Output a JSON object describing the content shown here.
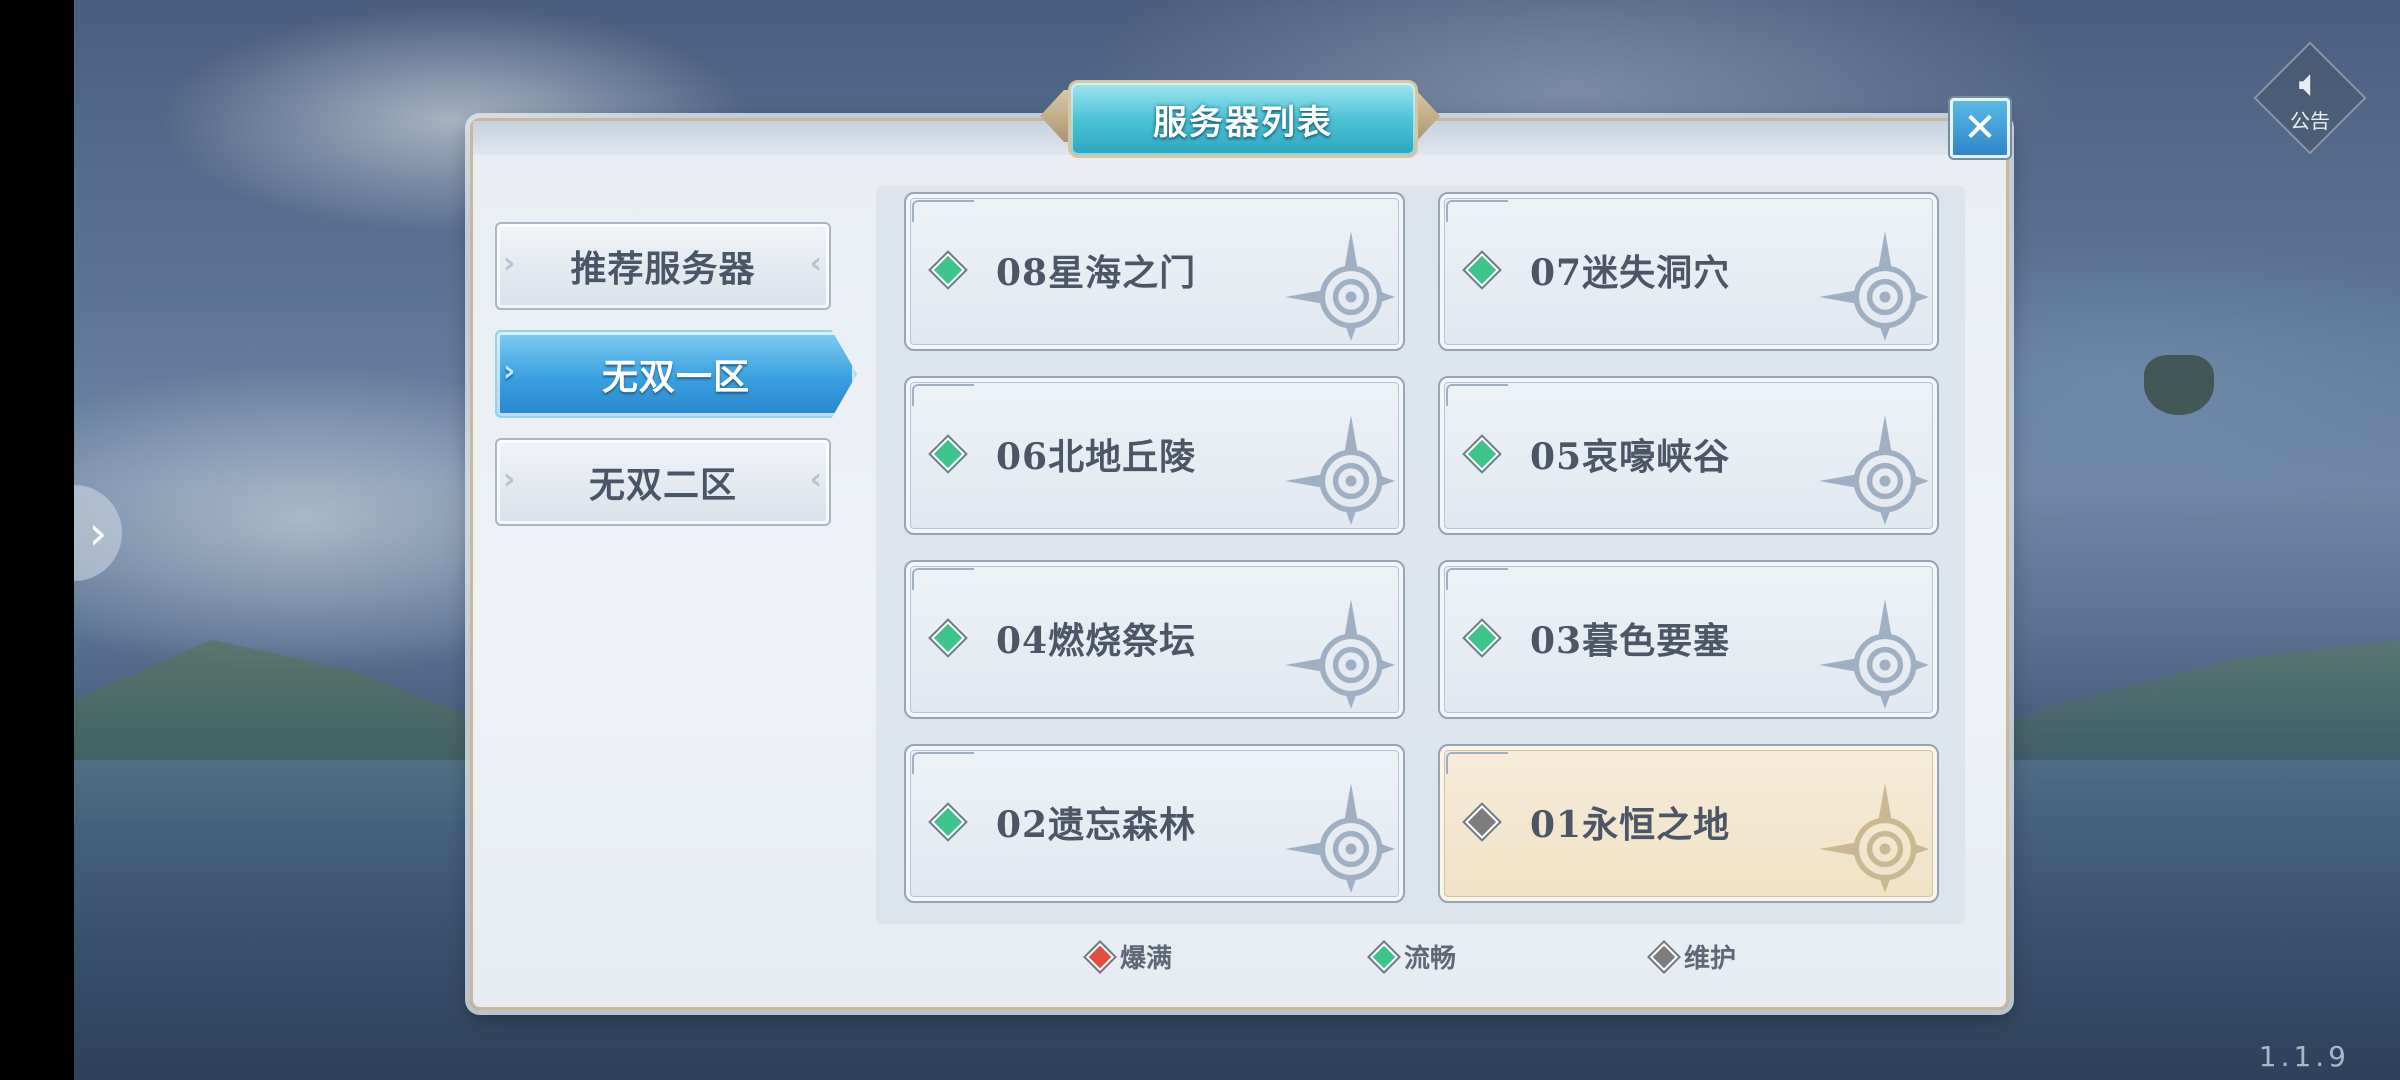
{
  "dialog": {
    "title": "服务器列表"
  },
  "notice": {
    "label": "公告"
  },
  "version": "1.1.9",
  "tabs": [
    {
      "label": "推荐服务器",
      "active": false
    },
    {
      "label": "无双一区",
      "active": true
    },
    {
      "label": "无双二区",
      "active": false
    }
  ],
  "servers": [
    {
      "name": "08星海之门",
      "status": "流畅"
    },
    {
      "name": "07迷失洞穴",
      "status": "流畅"
    },
    {
      "name": "06北地丘陵",
      "status": "流畅"
    },
    {
      "name": "05哀嚎峡谷",
      "status": "流畅"
    },
    {
      "name": "04燃烧祭坛",
      "status": "流畅"
    },
    {
      "name": "03暮色要塞",
      "status": "流畅"
    },
    {
      "name": "02遗忘森林",
      "status": "流畅"
    },
    {
      "name": "01永恒之地",
      "status": "维护"
    }
  ],
  "legend": [
    {
      "label": "爆满",
      "color": "#e0503c"
    },
    {
      "label": "流畅",
      "color": "#3cc48a"
    },
    {
      "label": "维护",
      "color": "#7d7d7d"
    }
  ],
  "colors": {
    "full": "#e0503c",
    "smooth": "#3cc48a",
    "maintenance": "#7d7d7d",
    "active_tab": "#3aa0e0"
  }
}
